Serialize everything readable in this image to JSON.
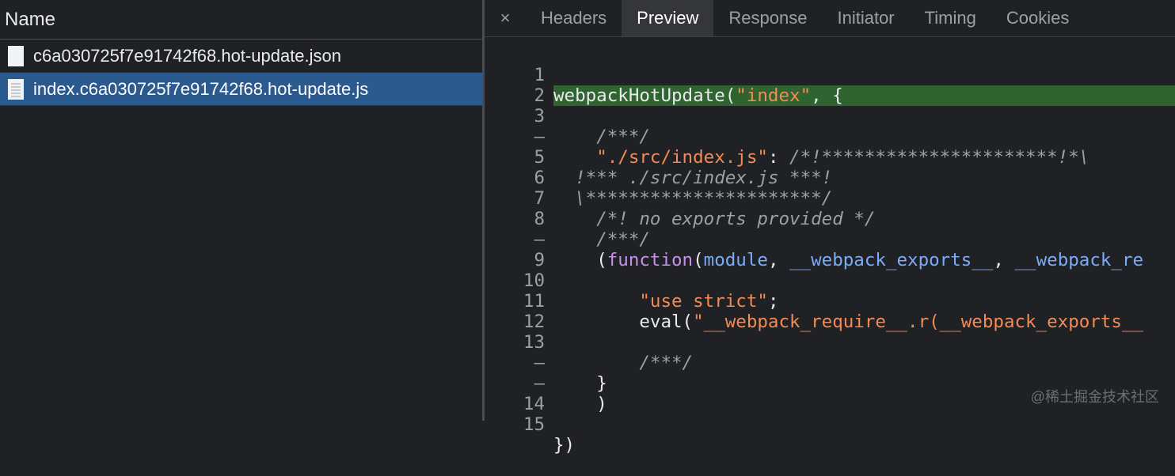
{
  "left_panel": {
    "header": "Name",
    "files": [
      {
        "name": "c6a030725f7e91742f68.hot-update.json",
        "icon": "json-file-icon"
      },
      {
        "name": "index.c6a030725f7e91742f68.hot-update.js",
        "icon": "js-file-icon"
      }
    ]
  },
  "tabs": {
    "close": "×",
    "items": [
      "Headers",
      "Preview",
      "Response",
      "Initiator",
      "Timing",
      "Cookies"
    ],
    "active": "Preview"
  },
  "code": {
    "line_numbers": [
      "1",
      "2",
      "3",
      "–",
      "5",
      "6",
      "7",
      "8",
      "–",
      "9",
      "10",
      "11",
      "12",
      "13",
      "–",
      "–",
      "14",
      "15"
    ],
    "l1_a": "webpackHotUpdate(",
    "l1_b": "\"index\"",
    "l1_c": ", {",
    "l3": "/***/",
    "l4_a": "\"./src/index.js\"",
    "l4_b": ": ",
    "l4_c": "/*!**********************!*\\",
    "l5": "!*** ./src/index.js ***!",
    "l6": "\\**********************/",
    "l7": "/*! no exports provided */",
    "l8": "/***/",
    "l9_a": "(",
    "l9_b": "function",
    "l9_c": "(",
    "l9_d": "module",
    "l9_e": ", ",
    "l9_f": "__webpack_exports__",
    "l9_g": ", ",
    "l9_h": "__webpack_re",
    "l11": "\"use strict\"",
    "l11_end": ";",
    "l12_a": "eval(",
    "l12_b": "\"__webpack_require__.r(__webpack_exports__",
    "l14": "/***/",
    "l15": "}",
    "l16": ")",
    "l18": "})"
  },
  "watermark": "@稀土掘金技术社区",
  "colors": {
    "background": "#202124",
    "selected_row": "#2b5a8f",
    "highlight_line": "#2f6431",
    "string": "#f28b54",
    "keyword": "#c792ea",
    "variable": "#7cacf8"
  }
}
